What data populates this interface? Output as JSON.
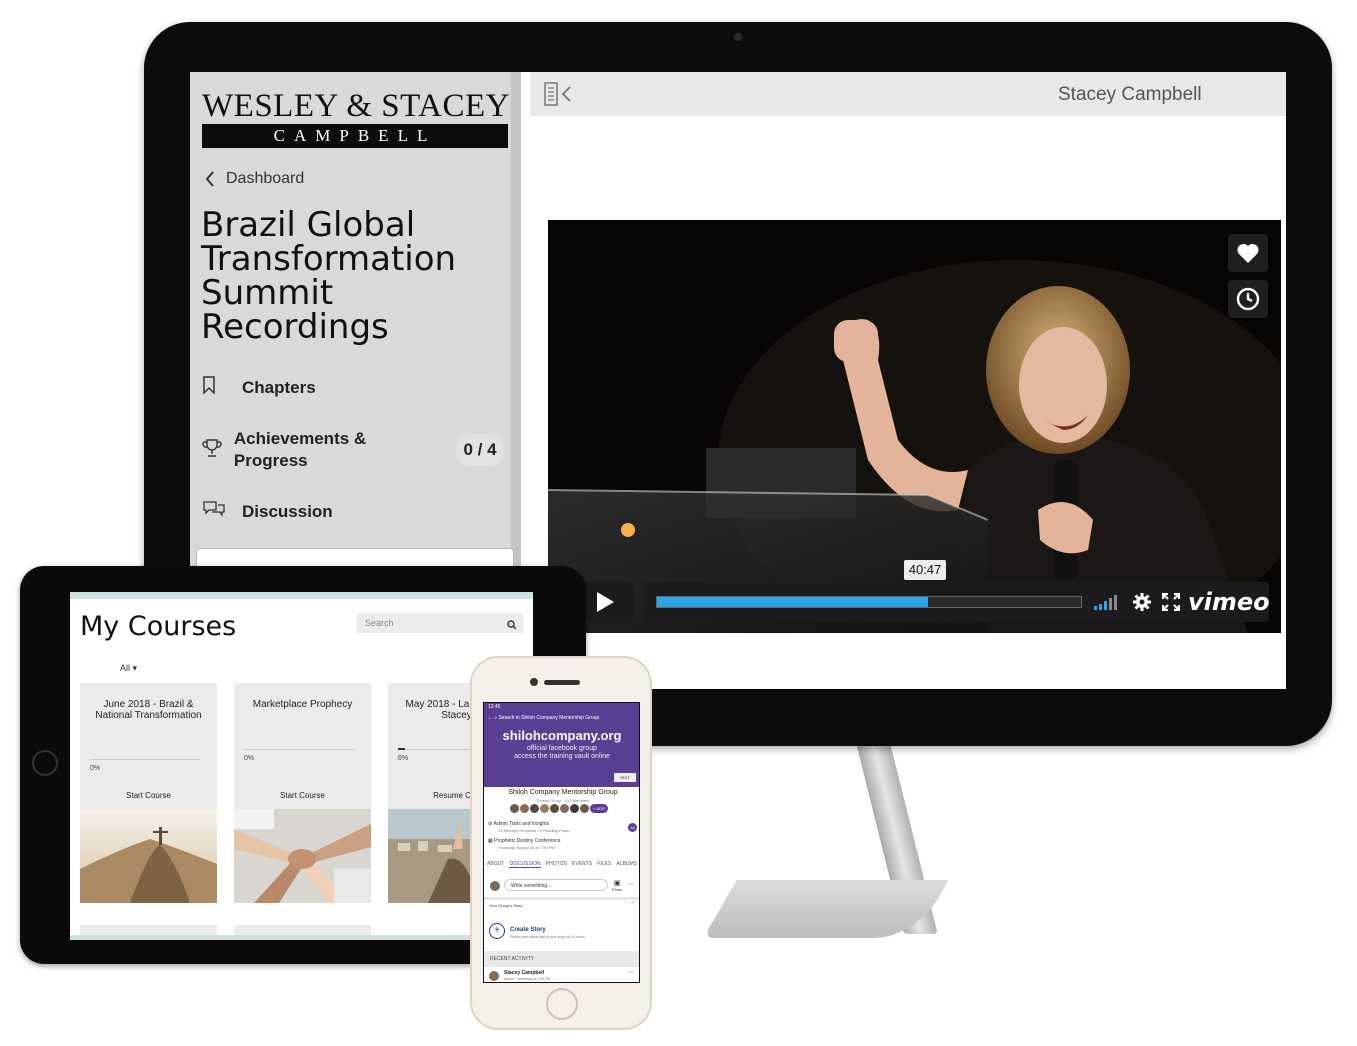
{
  "desktop": {
    "logo_top": "WESLEY & STACEY",
    "logo_bottom": "CAMPBELL",
    "back_label": "Dashboard",
    "course_title": "Brazil Global Transformation Summit Recordings",
    "nav": [
      {
        "label": "Chapters",
        "icon": "bookmark-icon"
      },
      {
        "label": "Achievements & Progress",
        "icon": "trophy-icon",
        "badge": "0 / 4"
      },
      {
        "label": "Discussion",
        "icon": "chat-bubbles-icon"
      }
    ],
    "user_name": "Stacey Campbell",
    "video": {
      "time_tooltip": "40:47",
      "progress": 0.64,
      "brand": "vimeo"
    },
    "colors": {
      "accent": "#2ea3e8",
      "sidebar_bg": "#d9d9d9"
    }
  },
  "tablet": {
    "title": "My Courses",
    "search_placeholder": "Search",
    "filter": "All",
    "cards": [
      {
        "title": "June 2018 - Brazil & National Transformation",
        "percent": "0%",
        "progress": 0.0,
        "action": "Start Course"
      },
      {
        "title": "Marketplace Prophecy",
        "percent": "0%",
        "progress": 0.0,
        "action": "Start Course"
      },
      {
        "title": "May 2018 - Lands Tour Stacey",
        "percent": "6%",
        "progress": 0.06,
        "action": "Resume Cou"
      }
    ]
  },
  "phone": {
    "status_time": "12:45",
    "search_text": "Search in Shiloh Company Mentorship Group",
    "banner_title": "shilohcompany.org",
    "banner_sub_1": "official facebook group",
    "banner_sub_2": "access the training vault online",
    "edit_label": "EDIT",
    "group_name": "Shiloh Company Mentorship Group",
    "group_meta": "Closed Group · 313 Members",
    "add_label": "+ ADD",
    "admin_tools": "Admin Tools and Insights",
    "admin_sub": "13 Member Requests • 3 Pending Posts",
    "admin_badge": "18",
    "event_title": "Prophetic Destiny Conference",
    "event_date": "Thursday, August 30 at 7:30 PM",
    "tabs": [
      "ABOUT",
      "DISCUSSION",
      "PHOTOS",
      "EVENTS",
      "FILES",
      "ALBUMS"
    ],
    "post_placeholder": "Write something...",
    "photo_label": "Photo",
    "story_header": "Your Group's Story",
    "create_story": "Create Story",
    "create_story_sub": "Photos and videos last in your story for 24 hours",
    "recent_activity": "RECENT ACTIVITY",
    "recent_user": "Stacey Campbell",
    "recent_meta": "Admin · Yesterday at 1:50 PM",
    "colors": {
      "header": "#5a3e93",
      "link": "#1d3b8a"
    }
  }
}
